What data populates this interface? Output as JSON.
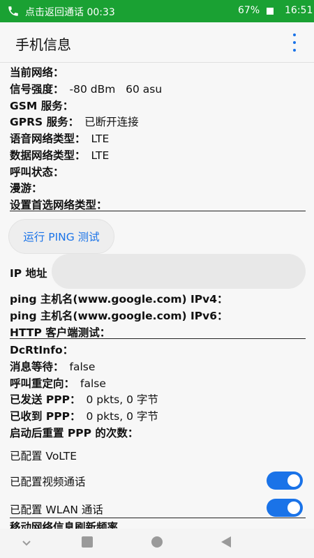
{
  "status_bar": {
    "call_text": "点击返回通话 00:33",
    "battery": "67%",
    "time": "16:51"
  },
  "app_bar": {
    "title": "手机信息"
  },
  "info": {
    "current_network": {
      "label": "当前网络：",
      "value": ""
    },
    "signal_strength": {
      "label": "信号强度：",
      "value": "-80 dBm   60 asu"
    },
    "gsm_service": {
      "label": "GSM 服务：",
      "value": ""
    },
    "gprs_service": {
      "label": "GPRS 服务：",
      "value": "已断开连接"
    },
    "voice_network_type": {
      "label": "语音网络类型：",
      "value": "LTE"
    },
    "data_network_type": {
      "label": "数据网络类型：",
      "value": "LTE"
    },
    "call_state": {
      "label": "呼叫状态：",
      "value": ""
    },
    "roaming": {
      "label": "漫游：",
      "value": ""
    },
    "preferred_network": {
      "label": "设置首选网络类型：",
      "value": ""
    }
  },
  "ping": {
    "button_label": "运行 PING 测试",
    "ip_label": "IP 地址",
    "ip_value": "",
    "ipv4_label": "ping 主机名(www.google.com) IPv4：",
    "ipv6_label": "ping 主机名(www.google.com) IPv6：",
    "http_label": "HTTP 客户端测试："
  },
  "details": {
    "dcrtinfo": {
      "label": "DcRtInfo：",
      "value": ""
    },
    "msg_waiting": {
      "label": "消息等待：",
      "value": "false"
    },
    "call_redirect": {
      "label": "呼叫重定向：",
      "value": "false"
    },
    "ppp_sent": {
      "label": "已发送 PPP：",
      "value": "0 pkts, 0 字节"
    },
    "ppp_received": {
      "label": "已收到 PPP：",
      "value": "0 pkts, 0 字节"
    },
    "ppp_reset": {
      "label": "启动后重置 PPP 的次数：",
      "value": ""
    }
  },
  "settings": {
    "volte_label": "已配置 VoLTE",
    "video_call_label": "已配置视频通话",
    "video_call_on": true,
    "wlan_call_label": "已配置 WLAN 通话",
    "wlan_call_on": true,
    "refresh_rate_label": "移动网络信息刷新频率"
  },
  "nav": {
    "icons": [
      "collapse-icon",
      "recents-icon",
      "home-icon",
      "back-icon"
    ]
  }
}
